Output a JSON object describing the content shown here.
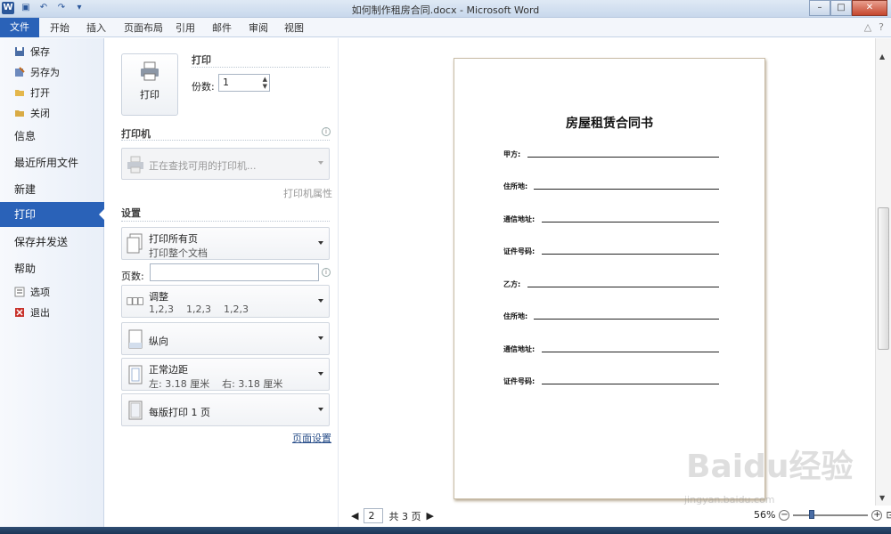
{
  "window": {
    "title": "如何制作租房合同.docx - Microsoft Word"
  },
  "ribbon": {
    "tabs": [
      "文件",
      "开始",
      "插入",
      "页面布局",
      "引用",
      "邮件",
      "审阅",
      "视图"
    ]
  },
  "nav": {
    "top_items": [
      {
        "label": "保存",
        "icon": "save-icon"
      },
      {
        "label": "另存为",
        "icon": "save-as-icon"
      },
      {
        "label": "打开",
        "icon": "open-folder-icon"
      },
      {
        "label": "关闭",
        "icon": "close-folder-icon"
      }
    ],
    "main_items": [
      "信息",
      "最近所用文件",
      "新建",
      "打印",
      "保存并发送",
      "帮助"
    ],
    "active": "打印",
    "bottom_items": [
      {
        "label": "选项",
        "icon": "options-icon"
      },
      {
        "label": "退出",
        "icon": "exit-icon"
      }
    ]
  },
  "print": {
    "section_title": "打印",
    "button_label": "打印",
    "copies_label": "份数:",
    "copies_value": "1",
    "printer_title": "打印机",
    "printer_status": "正在查找可用的打印机...",
    "printer_props": "打印机属性",
    "settings_title": "设置",
    "range_main": "打印所有页",
    "range_sub": "打印整个文档",
    "pages_label": "页数:",
    "pages_value": "",
    "collate_main": "调整",
    "collate_sub": "1,2,3    1,2,3    1,2,3",
    "orientation": "纵向",
    "margins_main": "正常边距",
    "margins_sub": "左: 3.18 厘米    右: 3.18 厘米",
    "per_sheet": "每版打印 1 页",
    "page_setup": "页面设置"
  },
  "document": {
    "title": "房屋租赁合同书",
    "fields": [
      "甲方:",
      "住所地:",
      "通信地址:",
      "证件号码:",
      "乙方:",
      "住所地:",
      "通信地址:",
      "证件号码:"
    ]
  },
  "pager": {
    "current": "2",
    "total": "共 3 页"
  },
  "zoom": {
    "value": "56%",
    "level_percent": 56
  },
  "watermark": {
    "logo": "Baidu经验",
    "url": "jingyan.baidu.com"
  }
}
